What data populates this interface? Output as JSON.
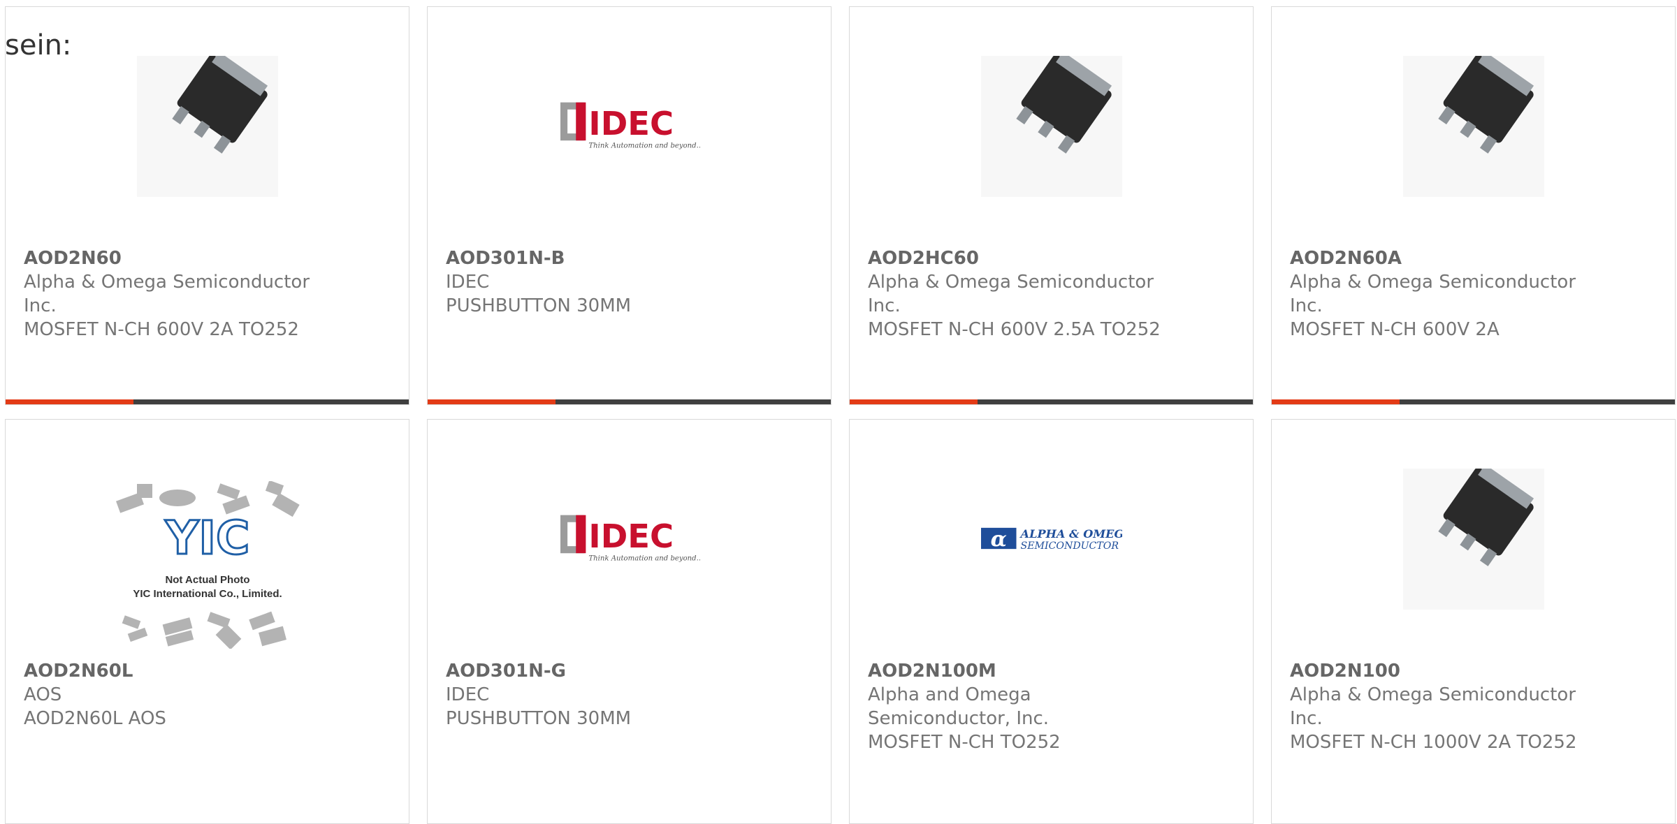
{
  "header_text": "sein:",
  "products": [
    {
      "part": "AOD2N60",
      "manufacturer": "Alpha & Omega Semiconductor Inc.",
      "description": "MOSFET N-CH 600V 2A TO252",
      "image": "to252-package-icon"
    },
    {
      "part": "AOD301N-B",
      "manufacturer": "IDEC",
      "description": "PUSHBUTTON 30MM",
      "image": "idec-logo",
      "logo_text": "IDEC",
      "logo_tagline": "Think Automation and beyond..."
    },
    {
      "part": "AOD2HC60",
      "manufacturer": "Alpha & Omega Semiconductor Inc.",
      "description": "MOSFET N-CH 600V 2.5A TO252",
      "image": "to252-package-icon"
    },
    {
      "part": "AOD2N60A",
      "manufacturer": "Alpha & Omega Semiconductor Inc.",
      "description": "MOSFET N-CH 600V 2A",
      "image": "to252-package-icon"
    },
    {
      "part": "AOD2N60L",
      "manufacturer": "AOS",
      "description": "AOD2N60L AOS",
      "image": "yic-placeholder",
      "logo_text": "YIC",
      "placeholder_line1": "Not Actual Photo",
      "placeholder_line2": "YIC International Co., Limited."
    },
    {
      "part": "AOD301N-G",
      "manufacturer": "IDEC",
      "description": "PUSHBUTTON 30MM",
      "image": "idec-logo",
      "logo_text": "IDEC",
      "logo_tagline": "Think Automation and beyond..."
    },
    {
      "part": "AOD2N100M",
      "manufacturer": "Alpha and Omega Semiconductor, Inc.",
      "description": "MOSFET N-CH TO252",
      "image": "aos-logo",
      "logo_line1": "ALPHA & OMEGA",
      "logo_line2": "SEMICONDUCTOR"
    },
    {
      "part": "AOD2N100",
      "manufacturer": "Alpha & Omega Semiconductor Inc.",
      "description": "MOSFET N-CH 1000V 2A TO252",
      "image": "to252-package-icon"
    }
  ],
  "colors": {
    "accent": "#e33b16",
    "bar": "#3f3f3f",
    "border": "#d9d9d9",
    "text": "#757575"
  }
}
